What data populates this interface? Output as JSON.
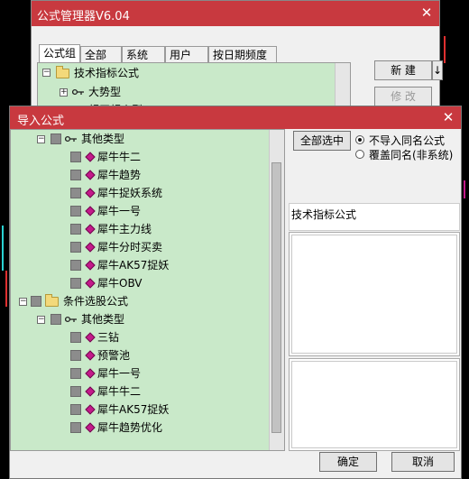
{
  "colors": {
    "titlebar": "#c8393f",
    "tree_bg": "#c9e9c9",
    "diamond": "#c41a8a",
    "dialog_bg": "#f0f0f0"
  },
  "formula_manager": {
    "title": "公式管理器V6.04",
    "close_label": "✕",
    "tabs": [
      "公式组",
      "全部",
      "系统",
      "用户",
      "按日期频度"
    ],
    "tree": [
      {
        "label": "技术指标公式",
        "icon": "folder-icon"
      },
      {
        "label": "大势型",
        "icon": "key-icon"
      },
      {
        "label": "超买超卖型",
        "icon": "key-icon"
      }
    ],
    "buttons": {
      "new": "新 建",
      "modify": "修 改"
    }
  },
  "import_dialog": {
    "title": "导入公式",
    "close_label": "✕",
    "select_all": "全部选中",
    "options": [
      {
        "label": "不导入同名公式",
        "selected": true
      },
      {
        "label": "覆盖同名(非系统)",
        "selected": false
      }
    ],
    "info_text": "技术指标公式",
    "ok": "确定",
    "cancel": "取消",
    "tree": [
      {
        "level": 1,
        "type": "key",
        "label": "其他类型"
      },
      {
        "level": 2,
        "type": "item",
        "label": "犀牛牛二"
      },
      {
        "level": 2,
        "type": "item",
        "label": "犀牛趋势"
      },
      {
        "level": 2,
        "type": "item",
        "label": "犀牛捉妖系统"
      },
      {
        "level": 2,
        "type": "item",
        "label": "犀牛一号"
      },
      {
        "level": 2,
        "type": "item",
        "label": "犀牛主力线"
      },
      {
        "level": 2,
        "type": "item",
        "label": "犀牛分时买卖"
      },
      {
        "level": 2,
        "type": "item",
        "label": "犀牛AK57捉妖"
      },
      {
        "level": 2,
        "type": "item",
        "label": "犀牛OBV"
      },
      {
        "level": 0,
        "type": "folder",
        "label": "条件选股公式"
      },
      {
        "level": 1,
        "type": "key",
        "label": "其他类型"
      },
      {
        "level": 2,
        "type": "item",
        "label": "三钻"
      },
      {
        "level": 2,
        "type": "item",
        "label": "预警池"
      },
      {
        "level": 2,
        "type": "item",
        "label": "犀牛一号"
      },
      {
        "level": 2,
        "type": "item",
        "label": "犀牛牛二"
      },
      {
        "level": 2,
        "type": "item",
        "label": "犀牛AK57捉妖"
      },
      {
        "level": 2,
        "type": "item",
        "label": "犀牛趋势优化"
      }
    ]
  }
}
